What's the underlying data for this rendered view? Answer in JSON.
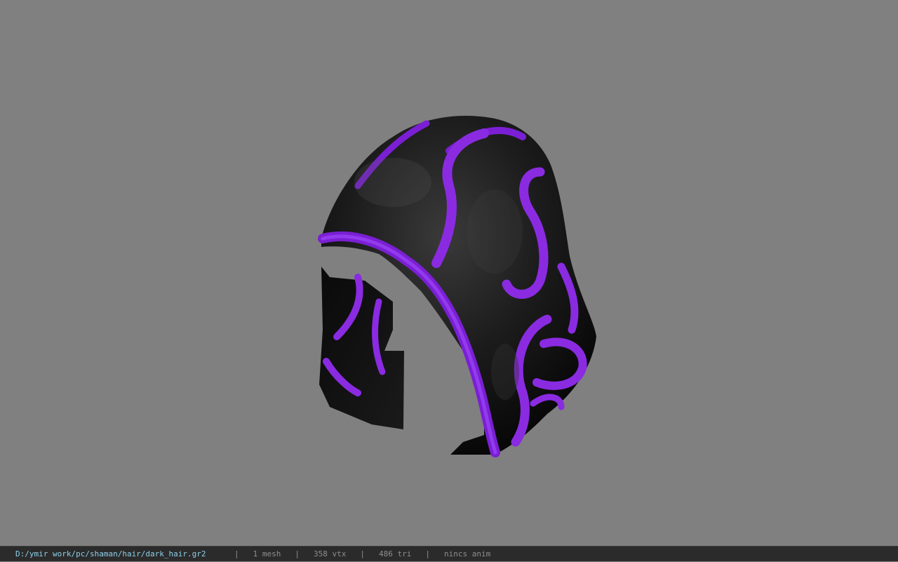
{
  "viewer": {
    "background_color": "#808080",
    "model": {
      "icon": "hood-model",
      "primary_color": "#121212",
      "accent_color": "#8a2be2"
    }
  },
  "status_bar": {
    "file_path": "D:/ymir work/pc/shaman/hair/dark_hair.gr2",
    "separator": "|",
    "mesh_count": "1 mesh",
    "vertex_count": "358 vtx",
    "triangle_count": "486 tri",
    "anim_status": "nincs anim",
    "file_color": "#8fd0ea",
    "text_color": "#8f8f8f"
  }
}
